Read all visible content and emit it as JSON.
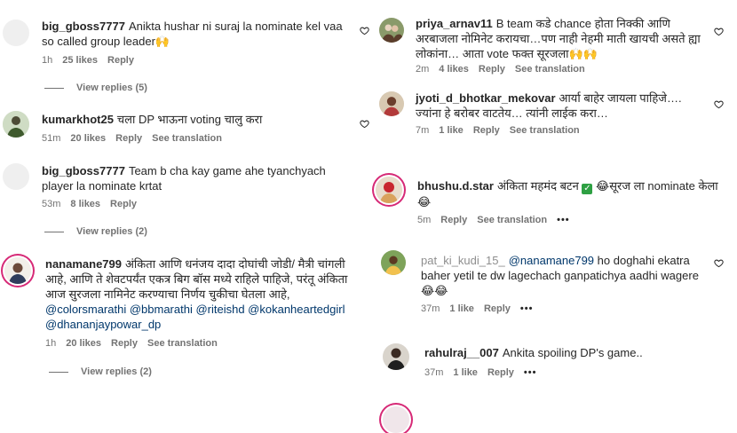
{
  "left": {
    "c1": {
      "user": "big_gboss7777",
      "text": "Anikta hushar ni suraj la nominate kel vaa so called group leader🙌",
      "time": "1h",
      "likes": "25 likes",
      "reply": "Reply",
      "view_replies": "View replies (5)"
    },
    "c2": {
      "user": "kumarkhot25",
      "text": "चला DP भाऊना voting चालु करा",
      "time": "51m",
      "likes": "20 likes",
      "reply": "Reply",
      "translate": "See translation"
    },
    "c3": {
      "user": "big_gboss7777",
      "text": "Team b cha kay game ahe tyanchyach player la nominate krtat",
      "time": "53m",
      "likes": "8 likes",
      "reply": "Reply",
      "view_replies": "View replies (2)"
    },
    "c4": {
      "user": "nanamane799",
      "text": "अंकिता आणि धनंजय दादा दोघांची जोडी/ मैत्री चांगली आहे, आणि ते शेवटपर्यंत एकत्र बिग बॉस मध्ये राहिले पाहिजे, परंतू अंकिता आज सुरजला नामिनेट करण्याचा निर्णय चुकीचा घेतला आहे,",
      "mentions": "@colorsmarathi @bbmarathi @riteishd @kokanheartedgirl @dhananjaypowar_dp",
      "time": "1h",
      "likes": "20 likes",
      "reply": "Reply",
      "translate": "See translation",
      "view_replies": "View replies (2)"
    }
  },
  "right": {
    "c1": {
      "user": "priya_arnav11",
      "text": "B team कडे chance होता निक्की आणि अरबाजला नोमिनेट करायचा…पण नाही नेहमी माती खायची असते ह्या लोकांना… आता vote फक्त सूरजला🙌🙌",
      "time": "2m",
      "likes": "4 likes",
      "reply": "Reply",
      "translate": "See translation"
    },
    "c2": {
      "user": "jyoti_d_bhotkar_mekovar",
      "text": "आर्या बाहेर जायला पाहिजे…. ज्यांना हे बरोबर वाटतेय… त्यांनी लाईक करा…",
      "time": "7m",
      "likes": "1 like",
      "reply": "Reply",
      "translate": "See translation"
    },
    "c3": {
      "user": "bhushu.d.star",
      "text_a": "अंकिता महमंद बटन",
      "check": "✓",
      "text_b": "😂सूरज ला nominate केला",
      "text_c": "😂",
      "time": "5m",
      "reply": "Reply",
      "translate": "See translation",
      "more": "•••"
    },
    "c4": {
      "user": "pat_ki_kudi_15_",
      "mention": "@nanamane799",
      "text": "ho doghahi ekatra baher yetil te dw lagechach ganpatichya aadhi wagere",
      "emoji": "😂😂",
      "time": "37m",
      "likes": "1 like",
      "reply": "Reply",
      "more": "•••"
    },
    "c5": {
      "user": "rahulraj__007",
      "text": "Ankita spoiling DP's game..",
      "time": "37m",
      "likes": "1 like",
      "reply": "Reply",
      "more": "•••"
    }
  },
  "colors": {
    "ring": "#d62976",
    "mention": "#00376b",
    "meta": "#737373",
    "check": "#2ea043"
  },
  "icons": [
    "heart-outline-icon",
    "default-avatar"
  ]
}
